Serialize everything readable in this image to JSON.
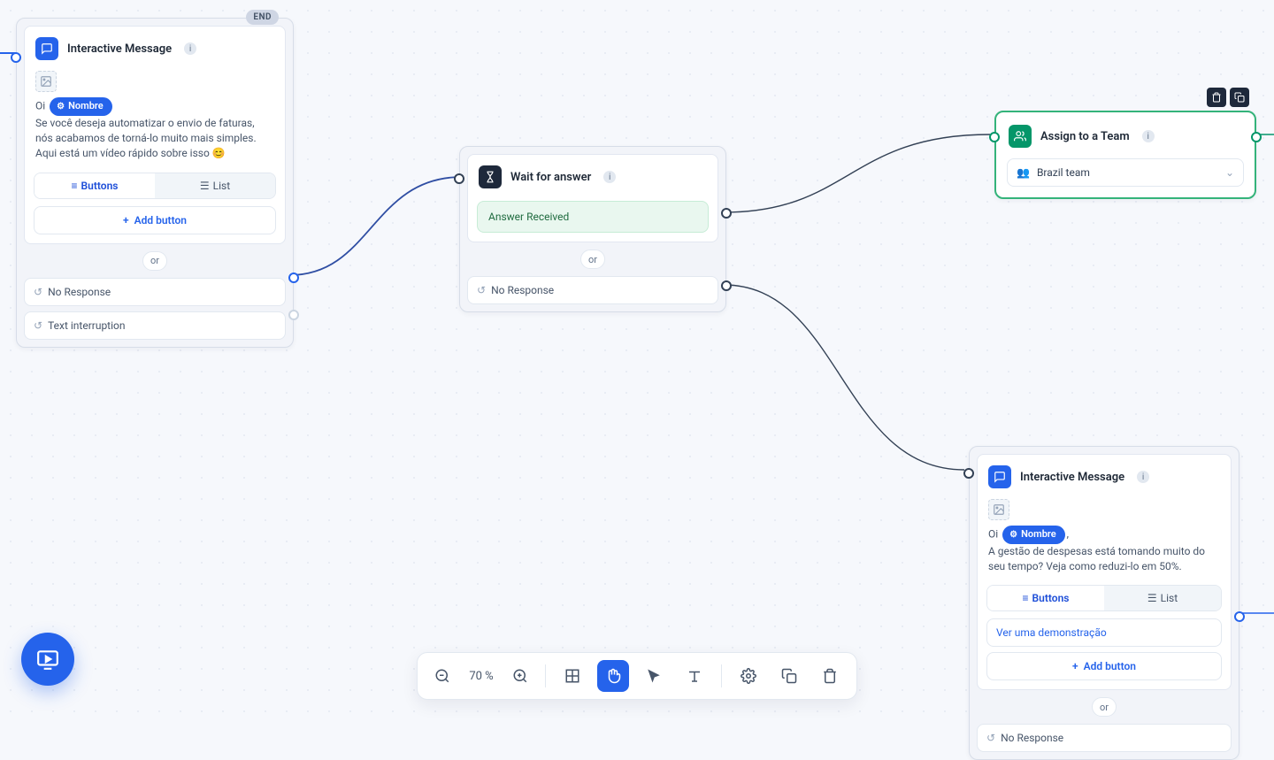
{
  "nodes": {
    "im1": {
      "title": "Interactive Message",
      "end_tag": "END",
      "greet": "Oi",
      "var_label": "Nombre",
      "body": "Se você deseja automatizar o envio de faturas, nós acabamos de torná-lo muito mais simples. Aqui está um vídeo rápido sobre isso 😊",
      "toggle": {
        "buttons": "Buttons",
        "list": "List"
      },
      "add_button": "Add button",
      "or": "or",
      "no_response": "No Response",
      "text_interruption": "Text interruption"
    },
    "wait": {
      "title": "Wait for answer",
      "answer_received": "Answer Received",
      "or": "or",
      "no_response": "No Response"
    },
    "assign": {
      "title": "Assign to a Team",
      "team": "Brazil team"
    },
    "im2": {
      "title": "Interactive Message",
      "greet": "Oi",
      "var_label": "Nombre",
      "body": "A gestão de despesas está tomando muito do seu tempo? Veja como reduzi-lo em 50%.",
      "toggle": {
        "buttons": "Buttons",
        "list": "List"
      },
      "demo_button": "Ver uma demonstração",
      "add_button": "Add button",
      "or": "or",
      "no_response": "No Response"
    }
  },
  "toolbar": {
    "zoom": "70 %"
  },
  "punct": {
    "comma": ","
  }
}
